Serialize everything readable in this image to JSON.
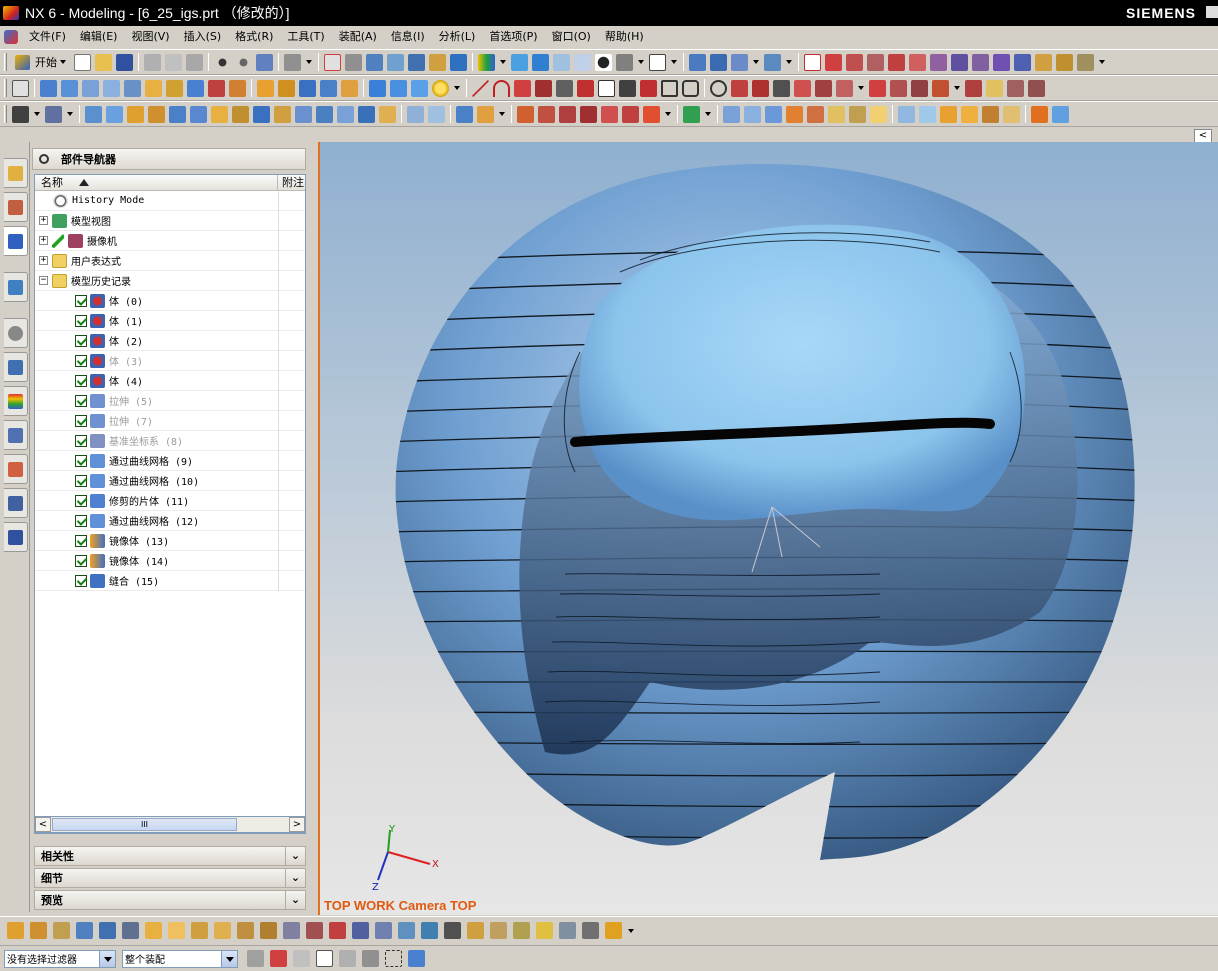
{
  "window": {
    "title": "NX 6 - Modeling - [6_25_igs.prt （修改的）]",
    "brand": "SIEMENS"
  },
  "menu": [
    "文件(F)",
    "编辑(E)",
    "视图(V)",
    "插入(S)",
    "格式(R)",
    "工具(T)",
    "装配(A)",
    "信息(I)",
    "分析(L)",
    "首选项(P)",
    "窗口(O)",
    "帮助(H)"
  ],
  "toolbar": {
    "start_label": "开始"
  },
  "navigator": {
    "title": "部件导航器",
    "col_name": "名称",
    "col_note": "附注",
    "rows": [
      {
        "label": "History Mode"
      },
      {
        "label": "模型视图"
      },
      {
        "label": "摄像机"
      },
      {
        "label": "用户表达式"
      },
      {
        "label": "模型历史记录"
      },
      {
        "label": "体 (0)"
      },
      {
        "label": "体 (1)"
      },
      {
        "label": "体 (2)"
      },
      {
        "label": "体 (3)"
      },
      {
        "label": "体 (4)"
      },
      {
        "label": "拉伸 (5)"
      },
      {
        "label": "拉伸 (7)"
      },
      {
        "label": "基准坐标系 (8)"
      },
      {
        "label": "通过曲线网格 (9)"
      },
      {
        "label": "通过曲线网格 (10)"
      },
      {
        "label": "修剪的片体 (11)"
      },
      {
        "label": "通过曲线网格 (12)"
      },
      {
        "label": "镜像体 (13)"
      },
      {
        "label": "镜像体 (14)"
      },
      {
        "label": "缝合 (15)"
      }
    ],
    "scroll_thumb": "III",
    "panels": [
      "相关性",
      "细节",
      "预览"
    ]
  },
  "viewport": {
    "label": "TOP WORK Camera TOP",
    "triad": {
      "x": "X",
      "y": "Y",
      "z": "Z"
    }
  },
  "status": {
    "filter": "没有选择过滤器",
    "scope": "整个装配"
  },
  "colors": {
    "accent_orange": "#e05a10",
    "surface_blue": "#6a9ad0"
  }
}
